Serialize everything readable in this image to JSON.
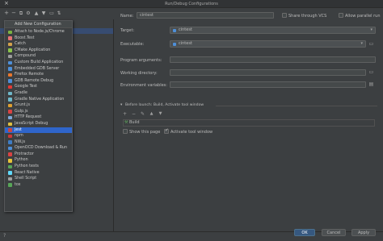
{
  "window": {
    "title": "Run/Debug Configurations"
  },
  "toolbar": {
    "icons": [
      "add-icon",
      "remove-icon",
      "copy-icon",
      "wrench-icon",
      "arrow-up-icon",
      "arrow-down-icon",
      "folder-icon",
      "sort-icon"
    ]
  },
  "popup": {
    "title": "Add New Configuration",
    "items": [
      {
        "label": "Attach to Node.js/Chrome",
        "color": "#7cb342"
      },
      {
        "label": "Boost.Test",
        "color": "#e57373"
      },
      {
        "label": "Catch",
        "color": "#d4a24c"
      },
      {
        "label": "CMake Application",
        "color": "#8bc34a"
      },
      {
        "label": "Compound",
        "color": "#9e9e9e"
      },
      {
        "label": "Custom Build Application",
        "color": "#4e8fd8"
      },
      {
        "label": "Embedded GDB Server",
        "color": "#4e8fd8"
      },
      {
        "label": "Firefox Remote",
        "color": "#e8772e"
      },
      {
        "label": "GDB Remote Debug",
        "color": "#4e8fd8"
      },
      {
        "label": "Google Test",
        "color": "#e53935"
      },
      {
        "label": "Gradle",
        "color": "#6fb8c9"
      },
      {
        "label": "Gradle Native Application",
        "color": "#6fb8c9"
      },
      {
        "label": "Grunt.js",
        "color": "#e0a030"
      },
      {
        "label": "Gulp.js",
        "color": "#d84343"
      },
      {
        "label": "HTTP Request",
        "color": "#7fa9d9"
      },
      {
        "label": "JavaScript Debug",
        "color": "#e0c040"
      },
      {
        "label": "Jest",
        "color": "#c9453f"
      },
      {
        "label": "npm",
        "color": "#cb3837"
      },
      {
        "label": "NW.js",
        "color": "#3e7cc4"
      },
      {
        "label": "OpenOCD Download & Run",
        "color": "#4e8fd8"
      },
      {
        "label": "Protractor",
        "color": "#d84343"
      },
      {
        "label": "Python",
        "color": "#e8c43a"
      },
      {
        "label": "Python tests",
        "color": "#58a658"
      },
      {
        "label": "React Native",
        "color": "#61dafb"
      },
      {
        "label": "Shell Script",
        "color": "#9e9e9e"
      },
      {
        "label": "tox",
        "color": "#58a658"
      }
    ],
    "selected_index": 16
  },
  "form": {
    "name_label": "Name:",
    "name_value": "cintest",
    "share_label": "Share through VCS",
    "parallel_label": "Allow parallel run",
    "target_label": "Target:",
    "target_value": "cintest",
    "executable_label": "Executable:",
    "executable_value": "cintest",
    "program_args_label": "Program arguments:",
    "working_dir_label": "Working directory:",
    "env_label": "Environment variables:",
    "before_launch_label": "Before launch: Build, Activate tool window",
    "build_item": "Build",
    "show_page_label": "Show this page",
    "activate_tool_label": "Activate tool window"
  },
  "buttons": {
    "ok": "OK",
    "cancel": "Cancel",
    "apply": "Apply"
  },
  "colors": {
    "accent": "#2f65ca",
    "bg": "#3c3f41",
    "ok": "#365880"
  }
}
